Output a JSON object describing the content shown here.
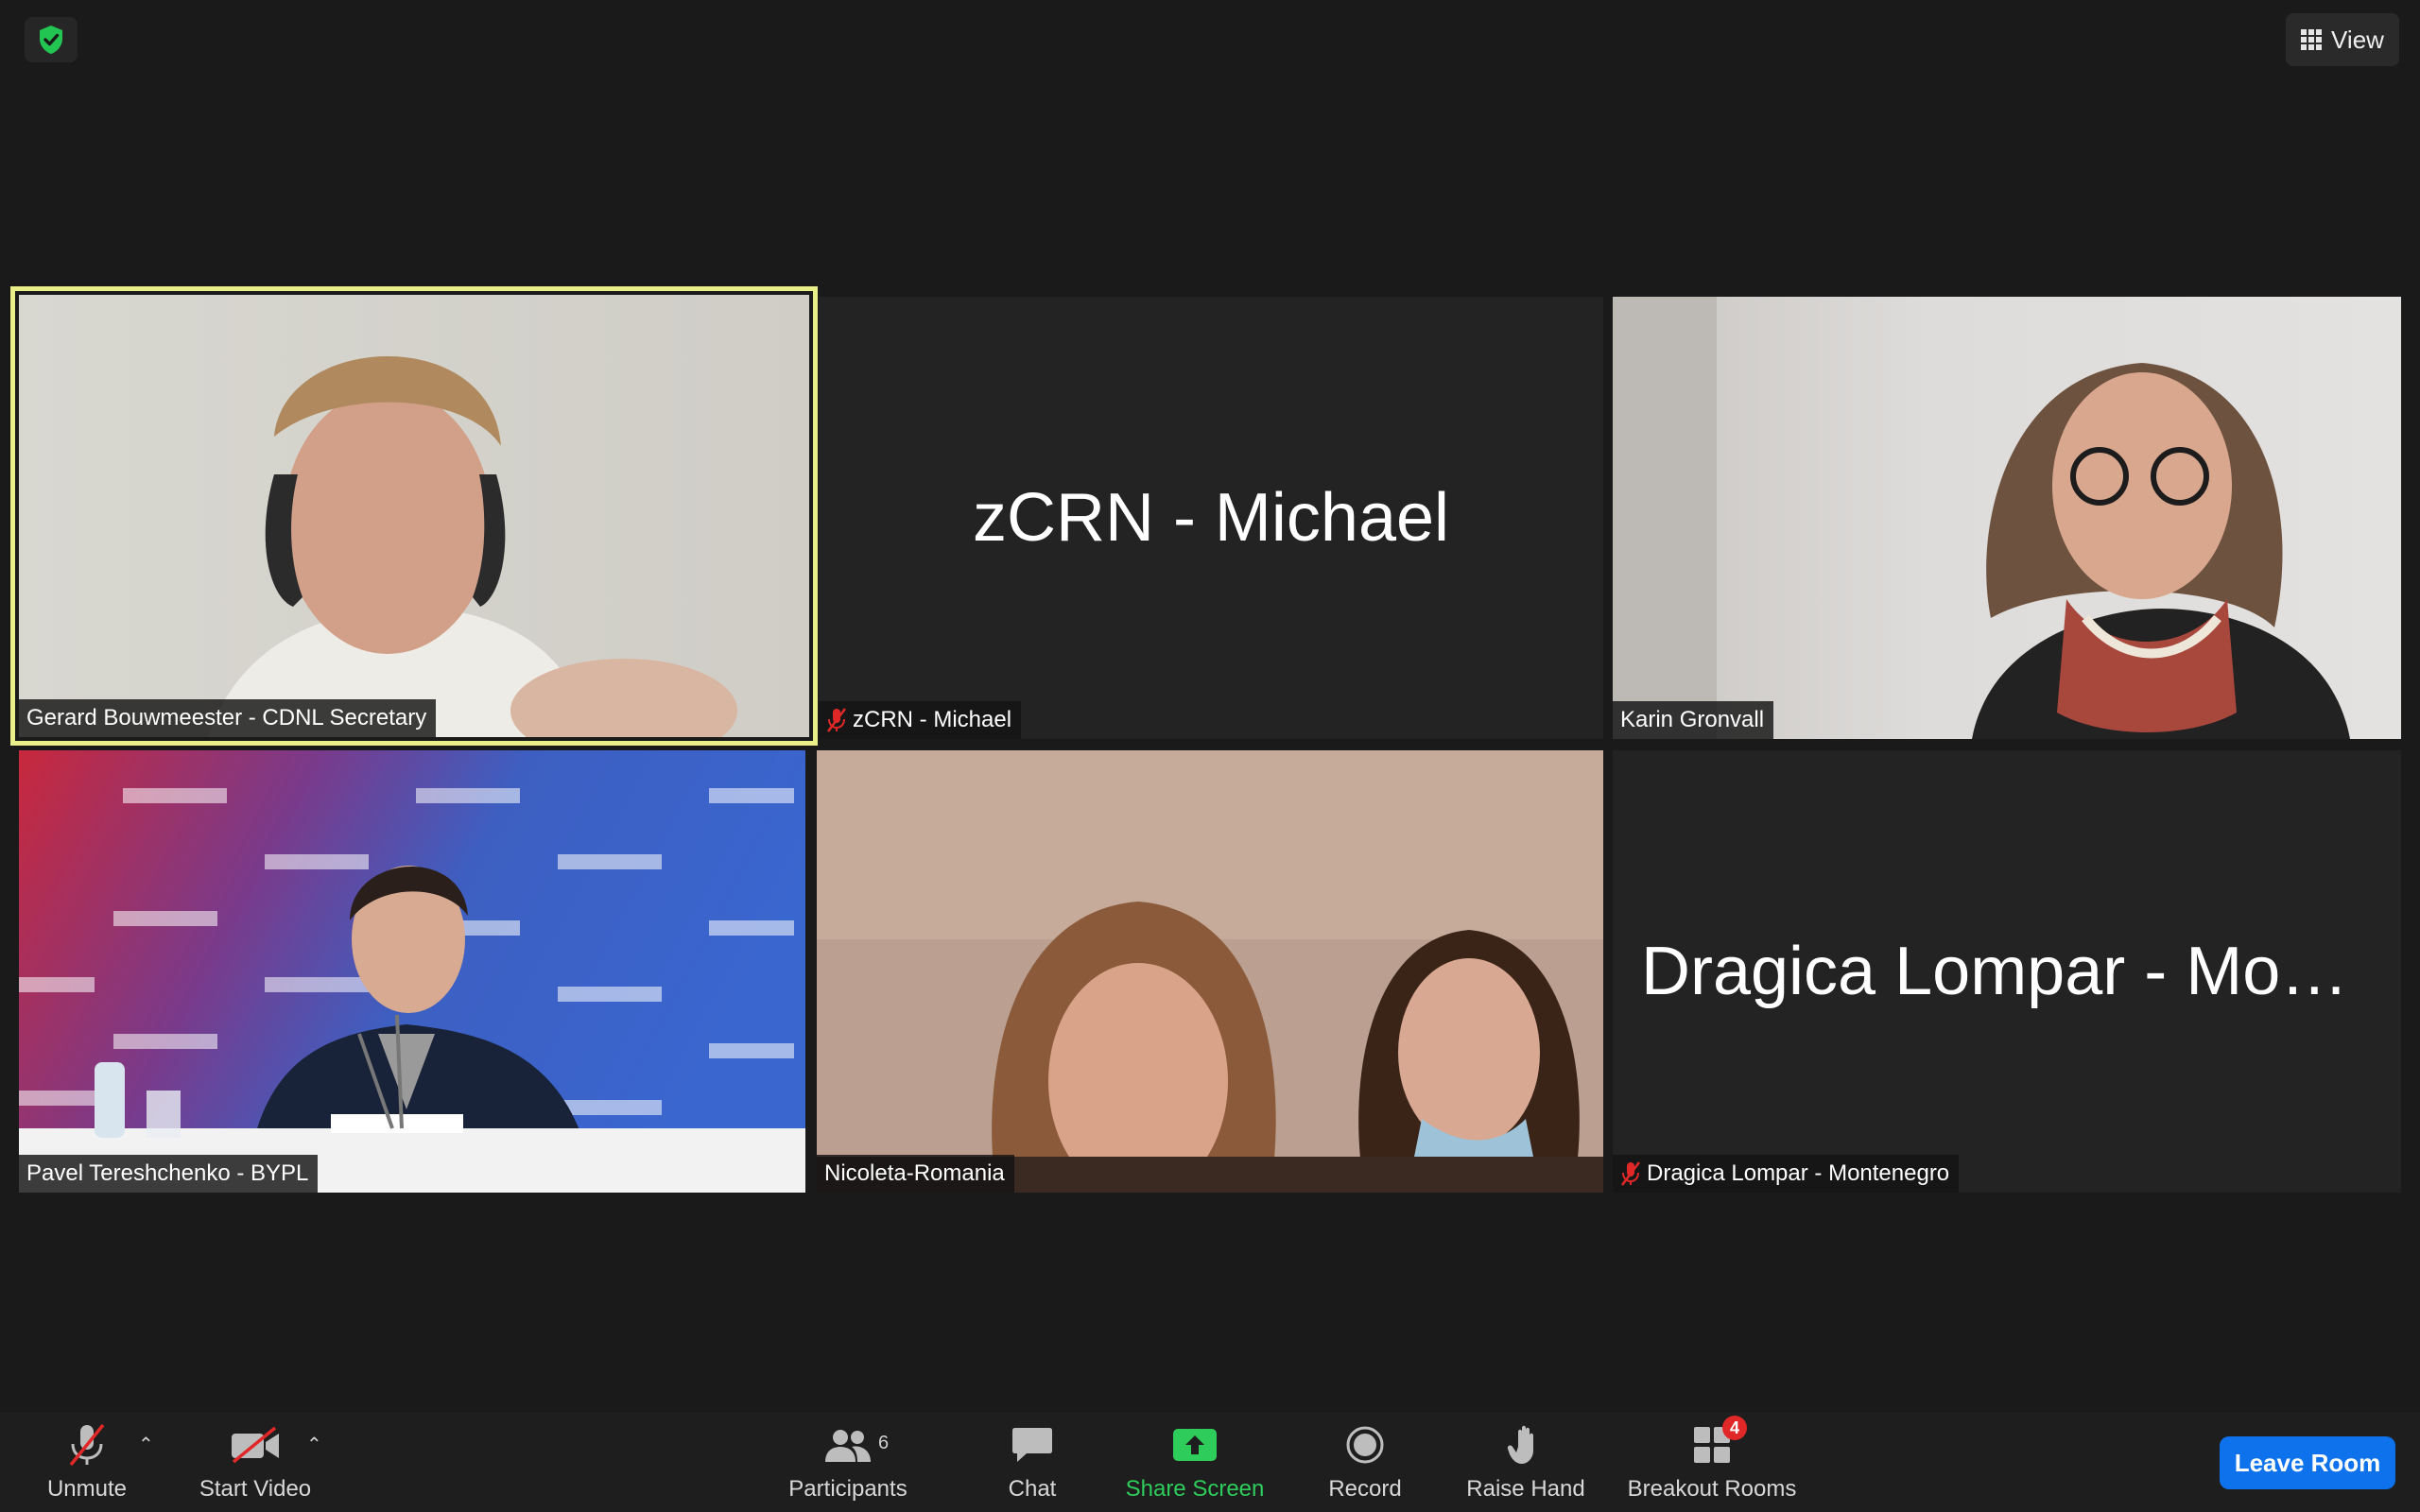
{
  "top": {
    "view_label": "View"
  },
  "tiles": [
    {
      "name": "Gerard Bouwmeester - CDNL Secretary",
      "muted": false,
      "video": true,
      "active": true
    },
    {
      "name": "zCRN - Michael",
      "big_name": "zCRN - Michael",
      "muted": true,
      "video": false
    },
    {
      "name": "Karin Gronvall",
      "muted": false,
      "video": true
    },
    {
      "name": "Pavel Tereshchenko - BYPL",
      "muted": false,
      "video": true
    },
    {
      "name": "Nicoleta-Romania",
      "muted": false,
      "video": true
    },
    {
      "name": "Dragica Lompar - Montenegro",
      "big_name": "Dragica Lompar - Monte...",
      "muted": true,
      "video": false
    }
  ],
  "toolbar": {
    "unmute": "Unmute",
    "start_video": "Start Video",
    "participants": "Participants",
    "participants_count": "6",
    "chat": "Chat",
    "share_screen": "Share Screen",
    "record": "Record",
    "raise_hand": "Raise Hand",
    "breakout_rooms": "Breakout Rooms",
    "breakout_badge": "4",
    "leave_room": "Leave Room"
  },
  "colors": {
    "background": "#1a1a1a",
    "active_speaker_border": "#e9f08a",
    "share_green": "#2ecc5a",
    "leave_blue": "#0e72ed",
    "mute_red": "#e02828"
  }
}
